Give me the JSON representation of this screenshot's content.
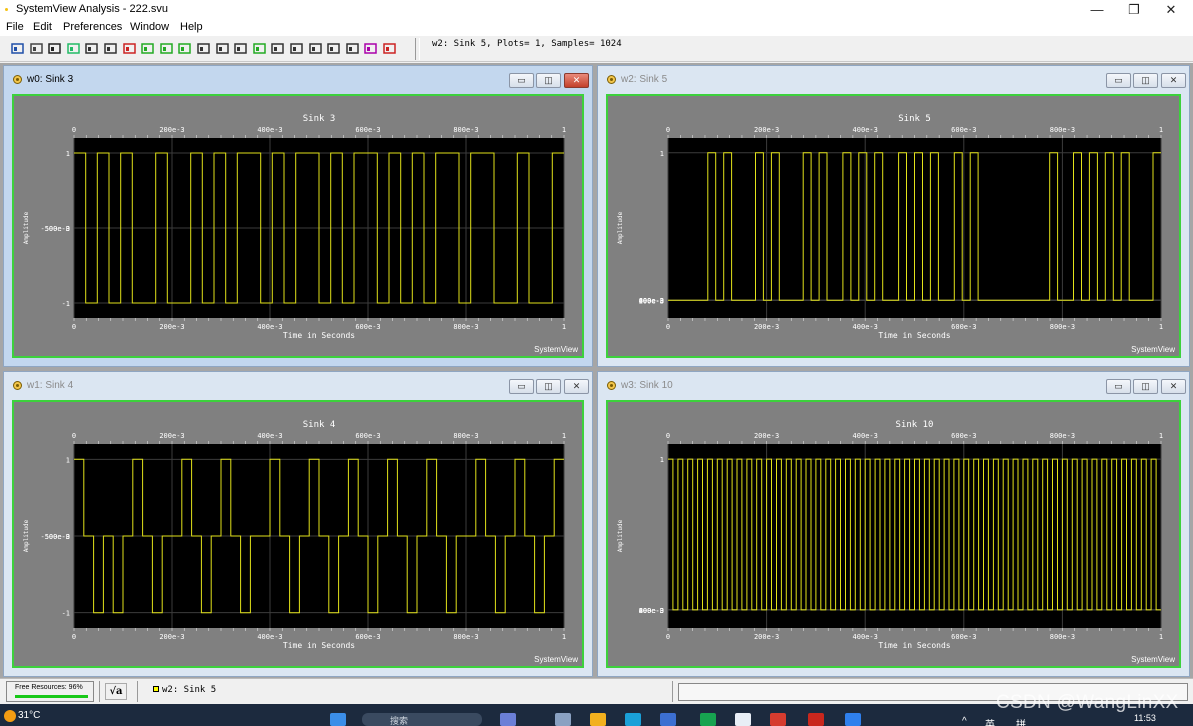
{
  "window": {
    "title": "SystemView Analysis - 222.svu",
    "minimize": "—",
    "restore": "❐",
    "close": "✕"
  },
  "menu": [
    "File",
    "Edit",
    "Preferences",
    "Window",
    "Help"
  ],
  "toolbar": {
    "status": "w2: Sink 5, Plots= 1, Samples= 1024",
    "icons": [
      "chart-icon",
      "print-icon",
      "move-icon",
      "scatter-icon",
      "line-icon",
      "bar-icon",
      "red-bar-icon",
      "grid-green-icon",
      "grid-green2-icon",
      "tile-green-icon",
      "histogram-icon",
      "stem-icon",
      "dots-icon",
      "tile-icon",
      "frame-icon",
      "triangle-icon",
      "cursor-icon",
      "zoom-icon",
      "crosshair-icon",
      "peak-icon",
      "scale-icon"
    ]
  },
  "subwindows": [
    {
      "id": "w0",
      "title": "w0: Sink 3",
      "active": true,
      "plot_title": "Sink 3",
      "ylabel": "Amplitude",
      "xlabel": "Time in Seconds",
      "top_ticks": [
        "0",
        "200e-3",
        "400e-3",
        "600e-3",
        "800e-3",
        "1"
      ],
      "bottom_ticks": [
        "0",
        "200e-3",
        "400e-3",
        "600e-3",
        "800e-3",
        "1"
      ],
      "y_ticks": [
        "1",
        "500e-3",
        "0",
        "-500e-3",
        "-1"
      ],
      "brand": "SystemView"
    },
    {
      "id": "w2",
      "title": "w2: Sink 5",
      "active": false,
      "plot_title": "Sink 5",
      "ylabel": "Amplitude",
      "xlabel": "Time in Seconds",
      "top_ticks": [
        "0",
        "200e-3",
        "400e-3",
        "600e-3",
        "800e-3",
        "1"
      ],
      "bottom_ticks": [
        "0",
        "200e-3",
        "400e-3",
        "600e-3",
        "800e-3",
        "1"
      ],
      "y_ticks": [
        "1",
        "800e-3",
        "600e-3",
        "400e-3",
        "200e-3",
        "0"
      ],
      "brand": "SystemView"
    },
    {
      "id": "w1",
      "title": "w1: Sink 4",
      "active": false,
      "plot_title": "Sink 4",
      "ylabel": "Amplitude",
      "xlabel": "Time in Seconds",
      "top_ticks": [
        "0",
        "200e-3",
        "400e-3",
        "600e-3",
        "800e-3",
        "1"
      ],
      "bottom_ticks": [
        "0",
        "200e-3",
        "400e-3",
        "600e-3",
        "800e-3",
        "1"
      ],
      "y_ticks": [
        "1",
        "500e-3",
        "0",
        "-500e-3",
        "-1"
      ],
      "brand": "SystemView"
    },
    {
      "id": "w3",
      "title": "w3: Sink 10",
      "active": false,
      "plot_title": "Sink 10",
      "ylabel": "Amplitude",
      "xlabel": "Time in Seconds",
      "top_ticks": [
        "0",
        "200e-3",
        "400e-3",
        "600e-3",
        "800e-3",
        "1"
      ],
      "bottom_ticks": [
        "0",
        "200e-3",
        "400e-3",
        "600e-3",
        "800e-3",
        "1"
      ],
      "y_ticks": [
        "1",
        "800e-3",
        "600e-3",
        "400e-3",
        "200e-3",
        "0"
      ],
      "brand": "SystemView"
    }
  ],
  "chart_data": [
    {
      "type": "line",
      "title": "Sink 3",
      "xlabel": "Time in Seconds",
      "ylabel": "Amplitude",
      "xlim": [
        0,
        1
      ],
      "ylim": [
        -1.2,
        1.2
      ],
      "series": [
        {
          "values": [
            1,
            -1,
            1,
            -1,
            1,
            -1,
            -1,
            1,
            -1,
            -1,
            1,
            -1,
            1,
            -1,
            1,
            1,
            -1,
            1,
            -1,
            1,
            1,
            -1,
            1,
            -1,
            1,
            1,
            -1,
            1,
            -1,
            1,
            -1,
            1,
            1,
            -1,
            1,
            1,
            -1,
            -1,
            1,
            -1,
            -1,
            1
          ]
        }
      ]
    },
    {
      "type": "line",
      "title": "Sink 5",
      "xlabel": "Time in Seconds",
      "ylabel": "Amplitude",
      "xlim": [
        0,
        1
      ],
      "ylim": [
        -0.12,
        1.1
      ],
      "series": [
        {
          "values": [
            0,
            0,
            0,
            0,
            0,
            1,
            0,
            1,
            0,
            0,
            0,
            1,
            0,
            1,
            0,
            0,
            0,
            1,
            0,
            1,
            0,
            0,
            1,
            0,
            1,
            0,
            1,
            0,
            0,
            1,
            0,
            1,
            0,
            1,
            0,
            0,
            1,
            0,
            1,
            0,
            0,
            0,
            0,
            0,
            0,
            0,
            0,
            0,
            1,
            0,
            0,
            1,
            0,
            1,
            0,
            1,
            0,
            1,
            0,
            0,
            0,
            1
          ]
        }
      ]
    },
    {
      "type": "line",
      "title": "Sink 4",
      "xlabel": "Time in Seconds",
      "ylabel": "Amplitude",
      "xlim": [
        0,
        1
      ],
      "ylim": [
        -1.2,
        1.2
      ],
      "series": [
        {
          "values": [
            1,
            0,
            -1,
            0,
            -1,
            0,
            1,
            0,
            -1,
            0,
            0,
            1,
            0,
            -1,
            0,
            1,
            0,
            -1,
            0,
            0,
            1,
            0,
            -1,
            0,
            1,
            0,
            -1,
            0,
            1,
            0,
            -1,
            0,
            1,
            0,
            -1,
            0,
            1,
            0,
            -1,
            0,
            0,
            1,
            0,
            -1,
            0,
            1,
            0,
            -1,
            0,
            1
          ]
        }
      ]
    },
    {
      "type": "line",
      "title": "Sink 10",
      "xlabel": "Time in Seconds",
      "ylabel": "Amplitude",
      "xlim": [
        0,
        1
      ],
      "ylim": [
        -0.12,
        1.1
      ],
      "series": [
        {
          "values": [
            1,
            0,
            1,
            0,
            1,
            0,
            1,
            0,
            1,
            0,
            1,
            0,
            1,
            0,
            1,
            0,
            1,
            0,
            1,
            0,
            1,
            0,
            1,
            0,
            1,
            0,
            1,
            0,
            1,
            0,
            1,
            0,
            1,
            0,
            1,
            0,
            1,
            0,
            1,
            0,
            1,
            0,
            1,
            0,
            1,
            0,
            1,
            0,
            1,
            0,
            1,
            0,
            1,
            0,
            1,
            0,
            1,
            0,
            1,
            0,
            1,
            0,
            1,
            0,
            1,
            0,
            1,
            0,
            1,
            0,
            1,
            0,
            1,
            0,
            1,
            0,
            1,
            0,
            1,
            0,
            1,
            0,
            1,
            0,
            1,
            0,
            1,
            0,
            1,
            0,
            1,
            0,
            1,
            0,
            1,
            0,
            1,
            0,
            1,
            0
          ]
        }
      ]
    }
  ],
  "status": {
    "resources": "Free Resources: 96%",
    "resources_fraction": 0.96,
    "sqrt_label": "√a",
    "sink": "w2: Sink 5"
  },
  "taskbar": {
    "temp": "31°C",
    "search": "搜索",
    "time": "11:53",
    "ime": "英",
    "ime2": "拼"
  },
  "watermark": "CSDN @WangLinXX"
}
